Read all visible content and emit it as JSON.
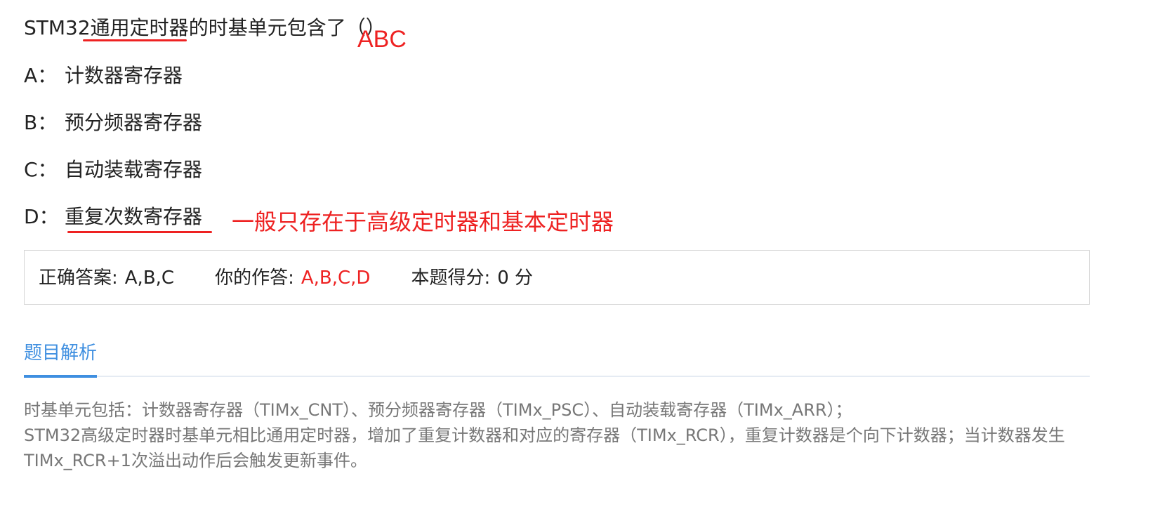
{
  "question": {
    "prefix": "STM32",
    "underlined": "通用定时器",
    "suffix": "的时基单元包含了（）"
  },
  "options": [
    {
      "letter": "A：",
      "text": "计数器寄存器"
    },
    {
      "letter": "B：",
      "text": "预分频器寄存器"
    },
    {
      "letter": "C：",
      "text": "自动装载寄存器"
    },
    {
      "letter": "D：",
      "text": "重复次数寄存器"
    }
  ],
  "annotations": {
    "abc": "ABC",
    "note": "一般只存在于高级定时器和基本定时器"
  },
  "answer": {
    "correct_label": "正确答案:",
    "correct_value": "A,B,C",
    "yours_label": "你的作答:",
    "yours_value": "A,B,C,D",
    "score_label": "本题得分:",
    "score_value": "0 分"
  },
  "tab": {
    "label": "题目解析"
  },
  "explanation": {
    "line1": "时基单元包括：计数器寄存器（TIMx_CNT）、预分频器寄存器（TIMx_PSC）、自动装载寄存器（TIMx_ARR）；",
    "line2": "STM32高级定时器时基单元相比通用定时器，增加了重复计数器和对应的寄存器（TIMx_RCR），重复计数器是个向下计数器；当计数器发生 TIMx_RCR+1次溢出动作后会触发更新事件。"
  },
  "colors": {
    "annotation_red": "#ee2222",
    "tab_blue": "#3f8fe0",
    "explain_gray": "#777777"
  }
}
